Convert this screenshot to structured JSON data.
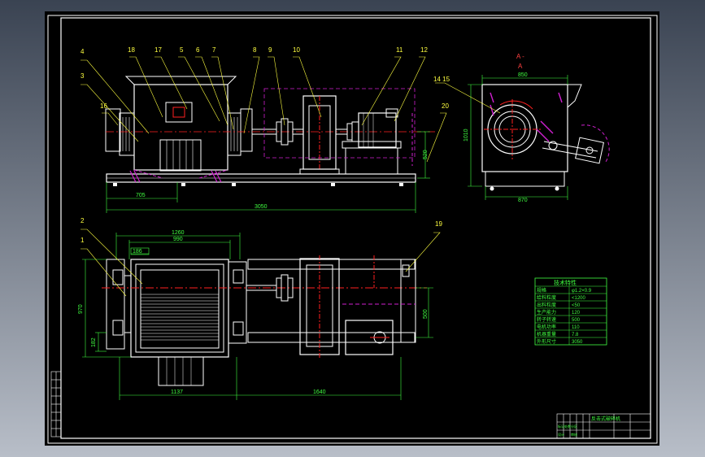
{
  "colors": {
    "background": "#000000",
    "outline": "#ffffff",
    "centerline": "#ff2020",
    "hidden": "#d020d0",
    "dimension": "#40ff40",
    "leader": "#ffff40"
  },
  "section_label": {
    "letter_top": "A -",
    "letter_bottom": "A"
  },
  "part_numbers": {
    "p1": "1",
    "p2": "2",
    "p3": "3",
    "p4": "4",
    "p5": "5",
    "p6": "6",
    "p7": "7",
    "p8": "8",
    "p9": "9",
    "p10": "10",
    "p11": "11",
    "p12": "12",
    "p1415": "14 15",
    "p16": "16",
    "p17": "17",
    "p18": "18",
    "p19": "19",
    "p20": "20"
  },
  "dimensions": {
    "d705": "705",
    "d3050": "3050",
    "d520": "520",
    "d850": "850",
    "d1010": "1010",
    "d870": "870",
    "d1260": "1260",
    "d990": "990",
    "d186": "186",
    "d970": "970",
    "d182": "182",
    "d500": "500",
    "d1137": "1137",
    "d1640": "1640"
  },
  "spec_table_title": "技术特性",
  "spec_rows": [
    {
      "label": "规格",
      "value": "φ1.2×0.9"
    },
    {
      "label": "给料粒度",
      "value": "<1200"
    },
    {
      "label": "出料粒度",
      "value": "<50"
    },
    {
      "label": "生产能力",
      "value": "120"
    },
    {
      "label": "转子转速",
      "value": "500"
    },
    {
      "label": "电机功率",
      "value": "110"
    },
    {
      "label": "机器重量",
      "value": "7.8"
    },
    {
      "label": "外形尺寸",
      "value": "3050"
    }
  ],
  "title_block": {
    "drawing_title": "反击式破碎机",
    "row_labels": [
      "标记",
      "处数",
      "分区",
      "设计",
      "审核"
    ]
  }
}
